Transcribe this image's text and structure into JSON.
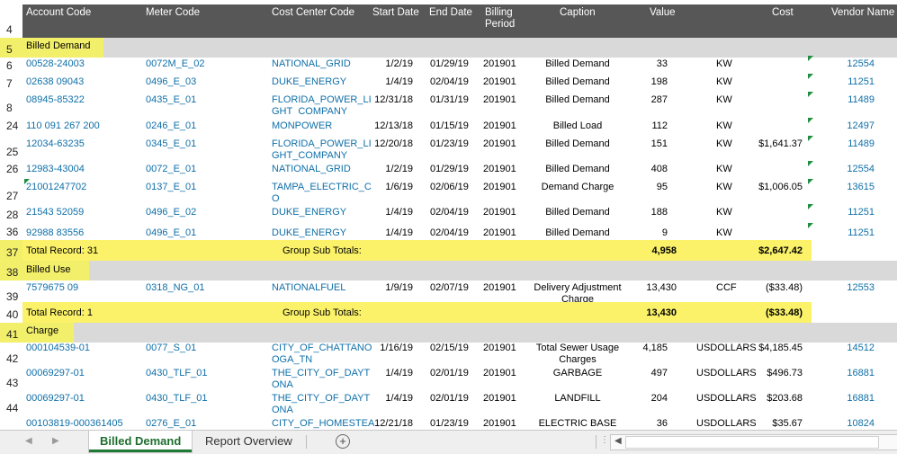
{
  "columns": {
    "account_code": "Account Code",
    "meter_code": "Meter Code",
    "cost_center_code": "Cost Center Code",
    "start_date": "Start Date",
    "end_date": "End Date",
    "billing_period_1": "Billing",
    "billing_period_2": "Period",
    "caption": "Caption",
    "value": "Value",
    "cost": "Cost",
    "vendor_name": "Vendor Name"
  },
  "row_numbers": {
    "r4": "4",
    "r5": "5",
    "r6": "6",
    "r7": "7",
    "r8": "8",
    "r24": "24",
    "r25": "25",
    "r26": "26",
    "r27": "27",
    "r28": "28",
    "r36": "36",
    "r37": "37",
    "r38": "38",
    "r39": "39",
    "r40": "40",
    "r41": "41",
    "r42": "42",
    "r43": "43",
    "r44": "44"
  },
  "groups": {
    "billed_demand": "Billed Demand",
    "billed_use": "Billed Use",
    "charge": "Charge"
  },
  "rows": [
    {
      "account": "00528-24003",
      "meter": "0072M_E_02",
      "cc1": "NATIONAL_GRID",
      "cc2": "",
      "start": "1/2/19",
      "end": "01/29/19",
      "period": "201901",
      "cap1": "Billed Demand",
      "cap2": "",
      "value": "33",
      "unit": "KW",
      "cost": "",
      "vendor": "12554"
    },
    {
      "account": "02638 09043",
      "meter": "0496_E_03",
      "cc1": "DUKE_ENERGY",
      "cc2": "",
      "start": "1/4/19",
      "end": "02/04/19",
      "period": "201901",
      "cap1": "Billed Demand",
      "cap2": "",
      "value": "198",
      "unit": "KW",
      "cost": "",
      "vendor": "11251"
    },
    {
      "account": "08945-85322",
      "meter": "0435_E_01",
      "cc1": "FLORIDA_POWER_LI",
      "cc2": "GHT_COMPANY",
      "start": "12/31/18",
      "end": "01/31/19",
      "period": "201901",
      "cap1": "Billed Demand",
      "cap2": "",
      "value": "287",
      "unit": "KW",
      "cost": "",
      "vendor": "11489"
    },
    {
      "account": "110 091 267 200",
      "meter": "0246_E_01",
      "cc1": "MONPOWER",
      "cc2": "",
      "start": "12/13/18",
      "end": "01/15/19",
      "period": "201901",
      "cap1": "Billed Load",
      "cap2": "",
      "value": "112",
      "unit": "KW",
      "cost": "",
      "vendor": "12497"
    },
    {
      "account": "12034-63235",
      "meter": "0345_E_01",
      "cc1": "FLORIDA_POWER_LI",
      "cc2": "GHT_COMPANY",
      "start": "12/20/18",
      "end": "01/23/19",
      "period": "201901",
      "cap1": "Billed Demand",
      "cap2": "",
      "value": "151",
      "unit": "KW",
      "cost": "$1,641.37",
      "vendor": "11489"
    },
    {
      "account": "12983-43004",
      "meter": "0072_E_01",
      "cc1": "NATIONAL_GRID",
      "cc2": "",
      "start": "1/2/19",
      "end": "01/29/19",
      "period": "201901",
      "cap1": "Billed Demand",
      "cap2": "",
      "value": "408",
      "unit": "KW",
      "cost": "",
      "vendor": "12554"
    },
    {
      "account": "21001247702",
      "meter": "0137_E_01",
      "cc1": "TAMPA_ELECTRIC_C",
      "cc2": "O",
      "start": "1/6/19",
      "end": "02/06/19",
      "period": "201901",
      "cap1": "Demand Charge",
      "cap2": "",
      "value": "95",
      "unit": "KW",
      "cost": "$1,006.05",
      "vendor": "13615"
    },
    {
      "account": "21543 52059",
      "meter": "0496_E_02",
      "cc1": "DUKE_ENERGY",
      "cc2": "",
      "start": "1/4/19",
      "end": "02/04/19",
      "period": "201901",
      "cap1": "Billed Demand",
      "cap2": "",
      "value": "188",
      "unit": "KW",
      "cost": "",
      "vendor": "11251"
    },
    {
      "account": "92988 83556",
      "meter": "0496_E_01",
      "cc1": "DUKE_ENERGY",
      "cc2": "",
      "start": "1/4/19",
      "end": "02/04/19",
      "period": "201901",
      "cap1": "Billed Demand",
      "cap2": "",
      "value": "9",
      "unit": "KW",
      "cost": "",
      "vendor": "11251"
    },
    {
      "account": "7579675 09",
      "meter": "0318_NG_01",
      "cc1": "NATIONALFUEL",
      "cc2": "",
      "start": "1/9/19",
      "end": "02/07/19",
      "period": "201901",
      "cap1": "Delivery Adjustment",
      "cap2": "Charge",
      "value": "13,430",
      "unit": "CCF",
      "cost": "($33.48)",
      "vendor": "12553"
    },
    {
      "account": "000104539-01",
      "meter": "0077_S_01",
      "cc1": "CITY_OF_CHATTANO",
      "cc2": "OGA_TN",
      "start": "1/16/19",
      "end": "02/15/19",
      "period": "201901",
      "cap1": "Total Sewer Usage",
      "cap2": "Charges",
      "value": "4,185",
      "unit": "USDOLLARS",
      "cost": "$4,185.45",
      "vendor": "14512"
    },
    {
      "account": "00069297-01",
      "meter": "0430_TLF_01",
      "cc1": "THE_CITY_OF_DAYT",
      "cc2": "ONA",
      "start": "1/4/19",
      "end": "02/01/19",
      "period": "201901",
      "cap1": "GARBAGE",
      "cap2": "",
      "value": "497",
      "unit": "USDOLLARS",
      "cost": "$496.73",
      "vendor": "16881"
    },
    {
      "account": "00069297-01",
      "meter": "0430_TLF_01",
      "cc1": "THE_CITY_OF_DAYT",
      "cc2": "ONA",
      "start": "1/4/19",
      "end": "02/01/19",
      "period": "201901",
      "cap1": "LANDFILL",
      "cap2": "",
      "value": "204",
      "unit": "USDOLLARS",
      "cost": "$203.68",
      "vendor": "16881"
    },
    {
      "account": "00103819-000361405",
      "meter": "0276_E_01",
      "cc1": "CITY_OF_HOMESTEA",
      "cc2": "",
      "start": "12/21/18",
      "end": "01/23/19",
      "period": "201901",
      "cap1": "ELECTRIC BASE",
      "cap2": "",
      "value": "36",
      "unit": "USDOLLARS",
      "cost": "$35.67",
      "vendor": "10824"
    }
  ],
  "totals": [
    {
      "label": "Total Record: 31",
      "sub": "Group Sub Totals:",
      "value": "4,958",
      "cost": "$2,647.42"
    },
    {
      "label": "Total Record: 1",
      "sub": "Group Sub Totals:",
      "value": "13,430",
      "cost": "($33.48)"
    }
  ],
  "tabs": {
    "active": "Billed Demand",
    "other": "Report Overview",
    "add_icon": "plus-circle-icon"
  },
  "colors": {
    "header_bg": "#575757",
    "group_bg": "#d9d9d9",
    "highlight": "#f2ef6a",
    "link_blue": "#0f6fa8",
    "active_tab": "#1e7a36"
  }
}
